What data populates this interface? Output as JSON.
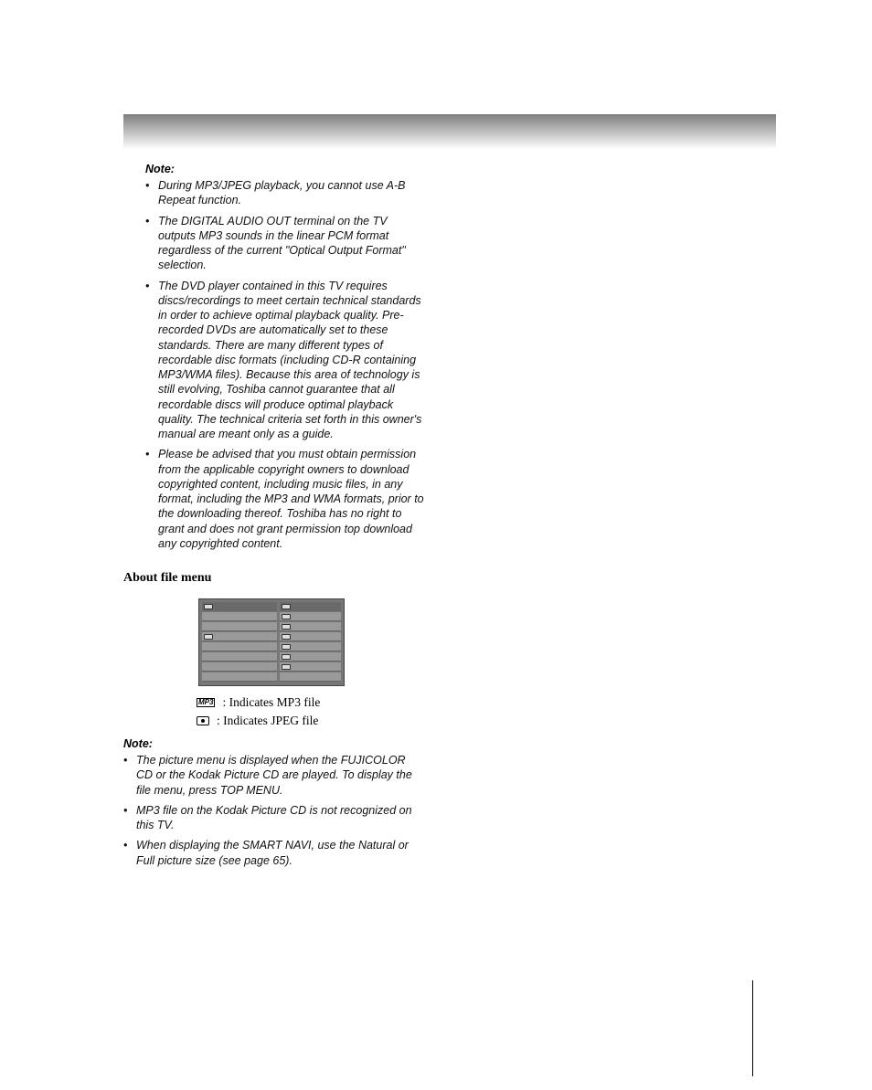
{
  "notes1": {
    "heading": "Note:",
    "items": [
      "During MP3/JPEG playback, you cannot use A-B Repeat function.",
      "The DIGITAL AUDIO OUT terminal on the TV outputs MP3 sounds in the linear PCM format regardless of the current \"Optical Output Format\" selection.",
      "The DVD player contained in this TV requires discs/recordings to meet certain technical standards in order to achieve optimal playback quality.  Pre-recorded DVDs are automatically set to these standards.  There are many different types of recordable disc formats (including CD-R containing MP3/WMA files).  Because this area of technology is still evolving, Toshiba cannot guarantee that all recordable discs will produce optimal playback quality. The technical criteria set forth in this owner's manual are meant only as a guide.",
      "Please be advised that you must obtain permission from the applicable copyright owners to download copyrighted content, including music files, in any format, including the MP3 and WMA formats, prior to the downloading thereof. Toshiba has no right to grant and does not grant permission top download any copyrighted content."
    ]
  },
  "section": {
    "heading": "About file menu",
    "icon_lines": [
      ": Indicates MP3 file",
      ": Indicates JPEG file"
    ]
  },
  "notes2": {
    "heading": "Note:",
    "items": [
      "The picture menu is displayed when the FUJICOLOR CD or the Kodak Picture CD are played. To display the file menu, press TOP MENU.",
      "MP3 file on the Kodak Picture CD is not recognized on this TV.",
      "When displaying the SMART NAVI, use the Natural or Full picture size (see page 65)."
    ]
  }
}
